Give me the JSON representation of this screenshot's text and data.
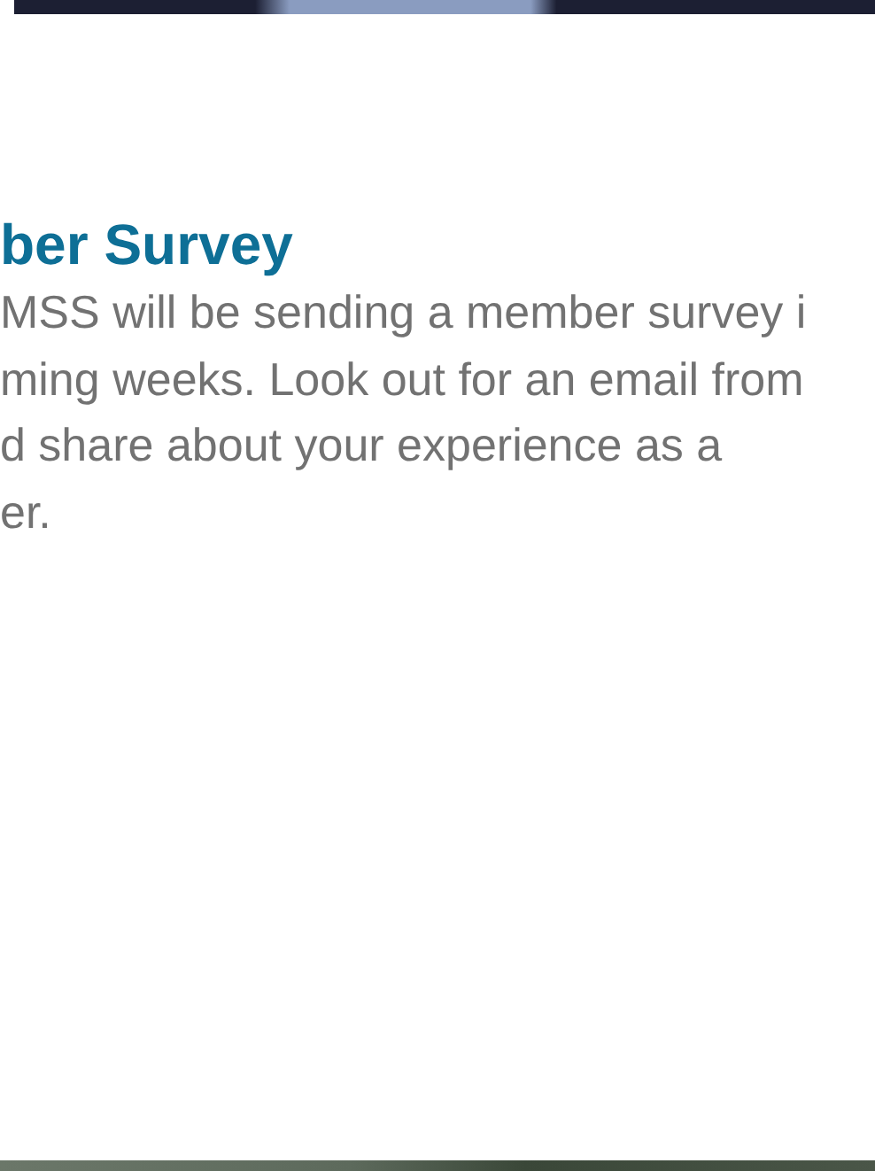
{
  "heading": "ber Survey",
  "body_lines": [
    "MSS will be sending a member survey i",
    "ming weeks. Look out for an email from",
    "d share about your experience as a",
    "er."
  ]
}
